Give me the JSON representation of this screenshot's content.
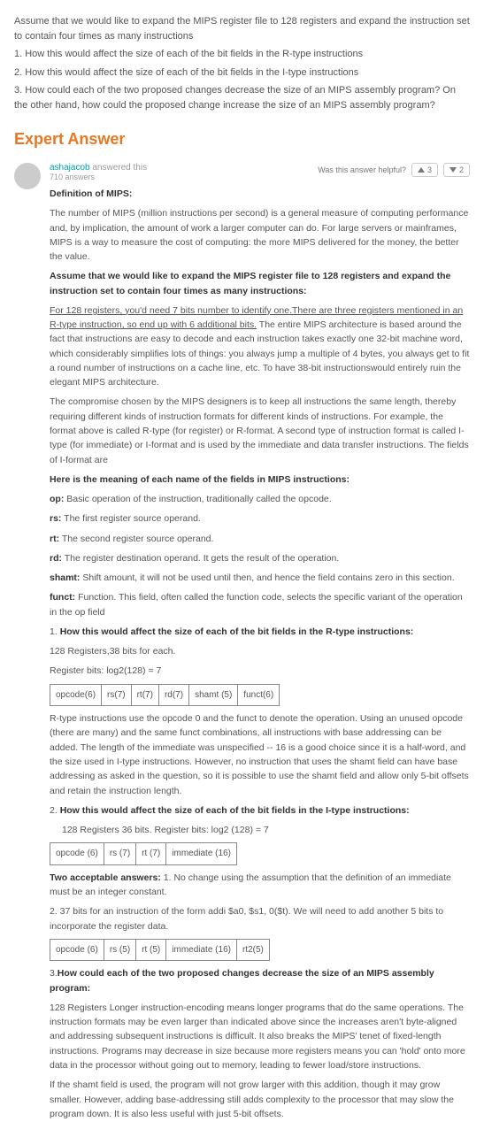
{
  "question": {
    "intro": "Assume that we would like to expand the MIPS register file to 128 registers and expand the instruction set to contain four times as many instructions",
    "p1": "1. How this would affect the size of each of the bit fields in the R-type instructions",
    "p2": "2. How this would affect the size of each of the bit fields in the I-type instructions",
    "p3": "3. How could each of the two proposed changes decrease the size of an MIPS assembly program? On the other hand, how could the proposed change increase the size of an MIPS assembly program?"
  },
  "header": "Expert Answer",
  "author": {
    "name": "ashajacob",
    "action": " answered this",
    "count": "710 answers"
  },
  "feedback": {
    "label": "Was this answer helpful?",
    "up": "3",
    "down": "2"
  },
  "c": {
    "h1": "Definition of MIPS:",
    "p1": "The number of MIPS (million instructions per second) is a general measure of computing performance and, by implication, the amount of work a larger computer can do. For large servers or mainframes, MIPS is a way to measure the cost of computing: the more MIPS delivered for the money, the better the value.",
    "h2": "Assume that we would like to expand the MIPS register file to 128 registers and expand the instruction set to contain four times as many instructions:",
    "p2a": "For 128 registers, you'd need 7 bits number to identify one.There are three registers mentioned in an R-type instruction, so end up with 6 additional bits.",
    "p2b": " The entire MIPS architecture is based around the fact that instructions are easy to decode and each instruction takes exactly one 32-bit machine word, which considerably simplifies lots of things: you always jump a multiple of 4 bytes, you always get to fit a round number of instructions on a cache line, etc. To have 38-bit instructionswould entirely ruin the elegant MIPS architecture.",
    "p3": "The compromise chosen by the MIPS designers is to keep all instructions the same length, thereby requiring different kinds of instruction formats for different kinds of instructions. For example, the format above is called R-type (for register) or R-format. A second type of instruction format is called I-type (for immediate) or I-format and is used by the immediate and data transfer instructions. The fields of I-format are",
    "h3": "Here is the meaning of each name of the fields in MIPS instructions:",
    "op": " Basic operation of the instruction, traditionally called the opcode.",
    "rs": " The first register source operand.",
    "rt": " The second register source operand.",
    "rd": " The register destination operand. It gets the result of the operation.",
    "shamt": " Shift amount, it will not be used until then, and hence the field contains zero in this section.",
    "funct": " Function. This field, often called the function code, selects the specific variant of the operation in the op field",
    "q1": "How this would affect the size of each of the bit fields in the R-type instructions:",
    "q1a": "128 Registers,38 bits for each.",
    "q1b": "Register bits: log2(128) = 7",
    "t1": {
      "c1": "opcode(6)",
      "c2": "rs(7)",
      "c3": "rt(7)",
      "c4": "rd(7)",
      "c5": "shamt (5)",
      "c6": "funct(6)"
    },
    "p4": "R-type instructions use the opcode 0 and the funct to denote the operation. Using an unused opcode (there are many) and the same funct combinations, all instructions with base addressing can be added. The length of the immediate was unspecified -- 16 is a good choice since it is a half-word, and the size used in I-type instructions. However, no instruction that uses the shamt field can have base addressing as asked in the question, so it is possible to use the shamt field and allow only 5-bit offsets and retain the instruction length.",
    "q2": "How this would affect the size of each of the bit fields in the I-type instructions:",
    "q2a": "128 Registers 36 bits. Register bits: log2 (128) = 7",
    "t2": {
      "c1": "opcode (6)",
      "c2": "rs (7)",
      "c3": "rt (7)",
      "c4": "immediate (16)"
    },
    "p5a": "Two acceptable answers:",
    "p5b": " 1. No change using the assumption that the definition of an immediate must be an integer constant.",
    "p6": "2. 37 bits for an instruction of the form addi $a0, $s1, 0($t). We will need to add another 5 bits to incorporate the register data.",
    "t3": {
      "c1": "opcode (6)",
      "c2": "rs (5)",
      "c3": "rt (5)",
      "c4": "immediate (16)",
      "c5": "rt2(5)"
    },
    "q3": "How could each of the two proposed changes decrease the size of an MIPS assembly program:",
    "p7": "128 Registers Longer instruction-encoding means longer programs that do the same operations. The instruction formats may be even larger than indicated above since the increases aren't byte-aligned and addressing subsequent instructions is difficult. It also breaks the MIPS' tenet of fixed-length instructions. Programs may decrease in size because more registers means you can 'hold' onto more data in the processor without going out to memory, leading to fewer load/store instructions.",
    "p8": "If the shamt field is used, the program will not grow larger with this addition, though it may grow smaller. However, adding base-addressing still adds complexity to the processor that may slow the program down. It is also less useful with just 5-bit offsets."
  }
}
